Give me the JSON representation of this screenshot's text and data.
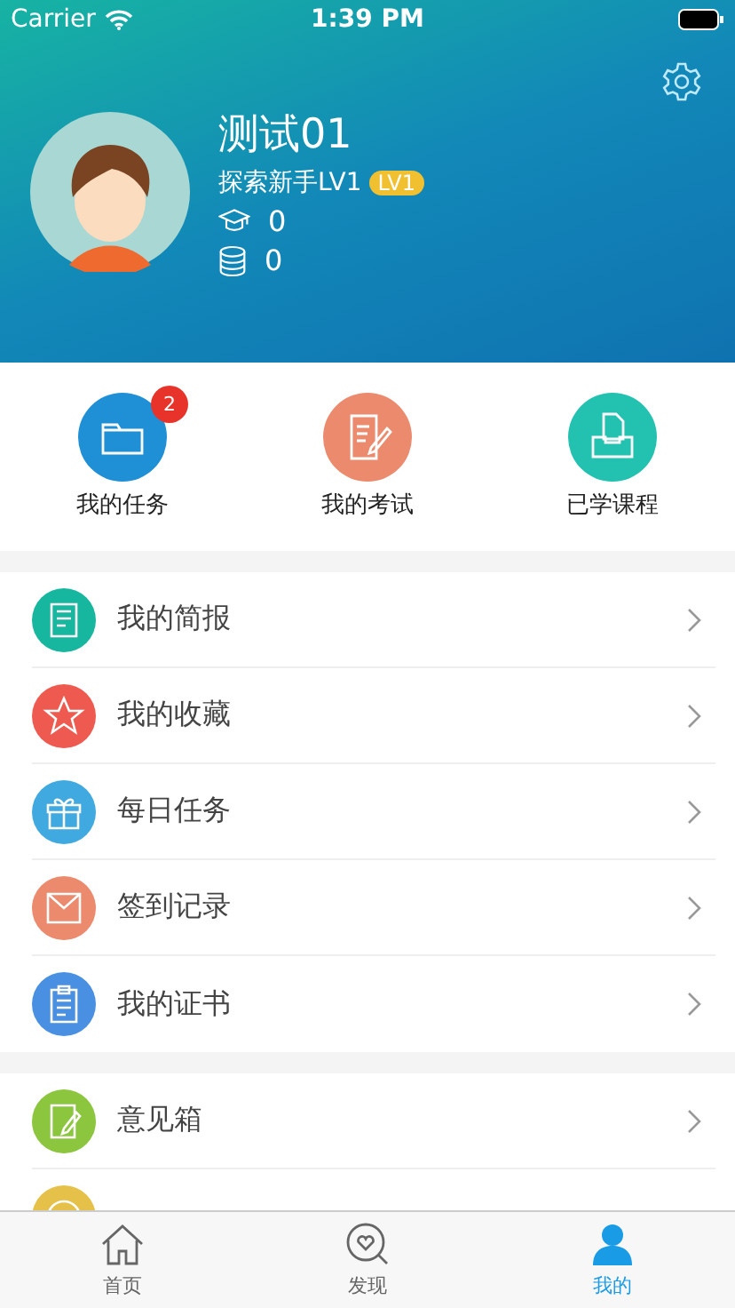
{
  "status_bar": {
    "carrier": "Carrier",
    "time": "1:39 PM"
  },
  "profile": {
    "name": "测试01",
    "title": "探索新手LV1",
    "level_badge": "LV1",
    "courses_count": "0",
    "coins_count": "0"
  },
  "shortcuts": [
    {
      "label": "我的任务",
      "color": "#1f8fd6",
      "badge": "2"
    },
    {
      "label": "我的考试",
      "color": "#ec8a6e"
    },
    {
      "label": "已学课程",
      "color": "#22c1b0"
    }
  ],
  "menu_groups": [
    {
      "items": [
        {
          "label": "我的简报",
          "color": "#17b69e"
        },
        {
          "label": "我的收藏",
          "color": "#ef5a50"
        },
        {
          "label": "每日任务",
          "color": "#3fa9e0"
        },
        {
          "label": "签到记录",
          "color": "#ec8a6e"
        },
        {
          "label": "我的证书",
          "color": "#4a90e2"
        }
      ]
    },
    {
      "items": [
        {
          "label": "意见箱",
          "color": "#8cc63f"
        },
        {
          "color": "#e6c14a"
        }
      ]
    }
  ],
  "tab_bar": [
    {
      "label": "首页",
      "selected": false
    },
    {
      "label": "发现",
      "selected": false
    },
    {
      "label": "我的",
      "selected": true
    }
  ]
}
